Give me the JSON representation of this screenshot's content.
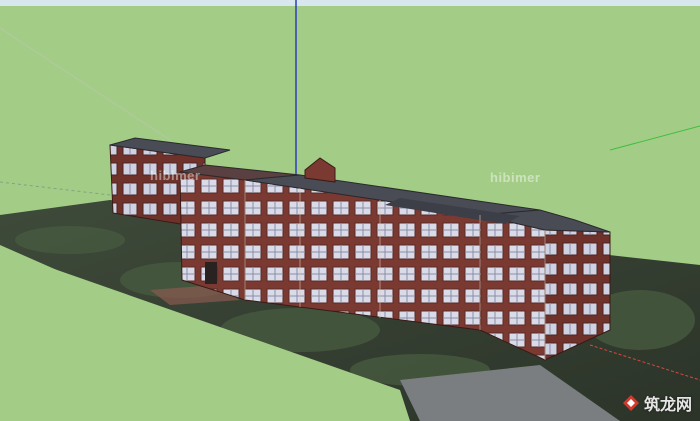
{
  "scene": {
    "type": "3d-model-viewport",
    "colors": {
      "sky": "#d8e6ee",
      "ground": "#a3cd86",
      "blue_axis": "#2b3fbe",
      "green_axis": "#3fbf3f",
      "red_axis": "#d34a3a",
      "brick": "#7a3a32",
      "roof": "#4a4c55",
      "window": "#d9dbe8"
    }
  },
  "watermarks": {
    "left": "hibimer",
    "right": "hibimer"
  },
  "logo": {
    "icon": "zhulong-logo-icon",
    "text": "筑龙网"
  }
}
